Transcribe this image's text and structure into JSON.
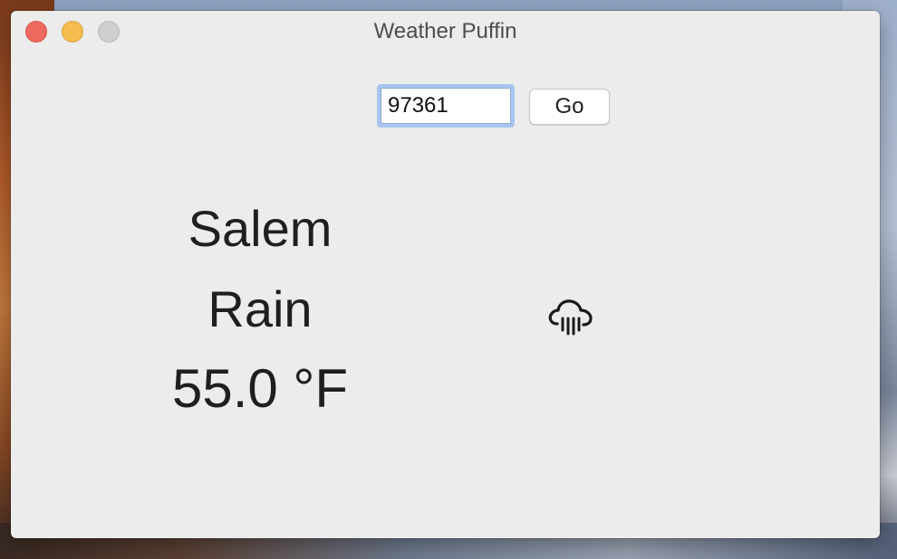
{
  "window": {
    "title": "Weather Puffin"
  },
  "search": {
    "zip_value": "97361",
    "go_label": "Go"
  },
  "weather": {
    "city": "Salem",
    "condition": "Rain",
    "temperature": "55.0 °F",
    "icon": "rain-cloud-icon"
  },
  "colors": {
    "close": "#ee6a5f",
    "minimize": "#f5bd4f",
    "zoom": "#cfcfcf",
    "focus_ring": "#a7c6f0",
    "window_bg": "#ececec"
  }
}
